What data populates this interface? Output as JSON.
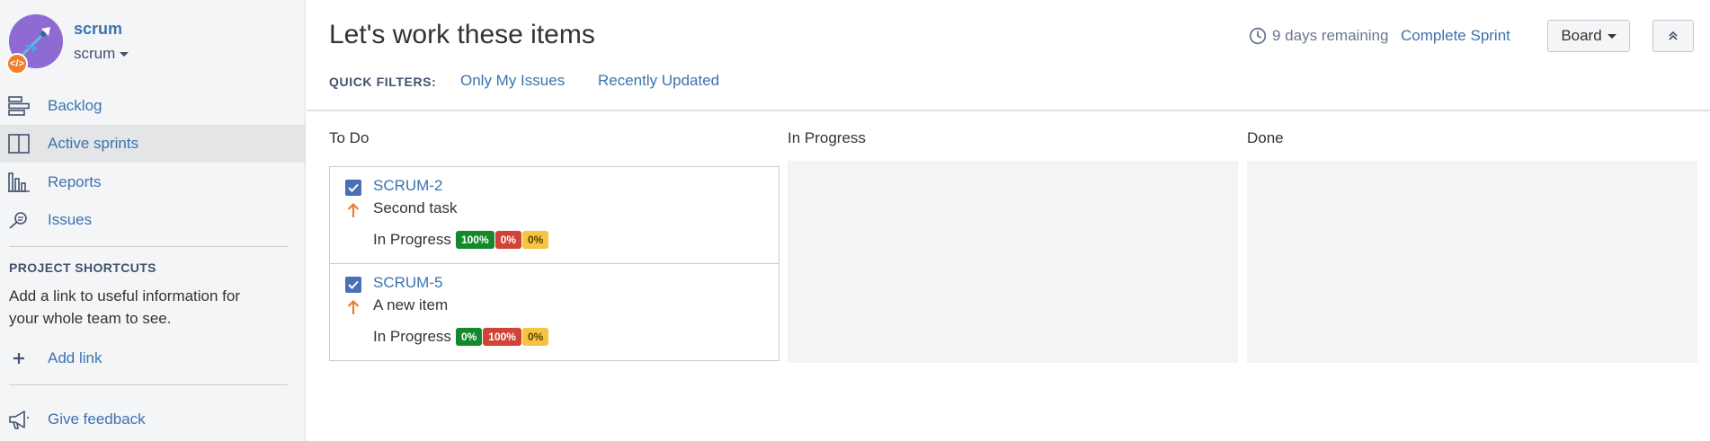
{
  "sidebar": {
    "project_name": "scrum",
    "project_type": "scrum",
    "nav": [
      {
        "label": "Backlog",
        "icon": "backlog-icon"
      },
      {
        "label": "Active sprints",
        "icon": "active-sprints-icon"
      },
      {
        "label": "Reports",
        "icon": "reports-icon"
      },
      {
        "label": "Issues",
        "icon": "issues-icon"
      }
    ],
    "shortcuts_title": "PROJECT SHORTCUTS",
    "shortcuts_text": "Add a link to useful information for your whole team to see.",
    "add_link_label": "Add link",
    "feedback_label": "Give feedback"
  },
  "header": {
    "title": "Let's work these items",
    "quick_filters_label": "QUICK FILTERS:",
    "quick_filters": [
      "Only My Issues",
      "Recently Updated"
    ],
    "days_remaining": "9 days remaining",
    "complete_sprint": "Complete Sprint",
    "board_button": "Board"
  },
  "columns": [
    "To Do",
    "In Progress",
    "Done"
  ],
  "cards": [
    {
      "key": "SCRUM-2",
      "summary": "Second task",
      "status": "In Progress",
      "pills": [
        {
          "label": "100%",
          "color": "#14892c"
        },
        {
          "label": "0%",
          "color": "#d04437"
        },
        {
          "label": "0%",
          "color": "#f6c342"
        }
      ]
    },
    {
      "key": "SCRUM-5",
      "summary": "A new item",
      "status": "In Progress",
      "pills": [
        {
          "label": "0%",
          "color": "#14892c"
        },
        {
          "label": "100%",
          "color": "#d04437"
        },
        {
          "label": "0%",
          "color": "#f6c342"
        }
      ]
    }
  ],
  "colors": {
    "link": "#3b73af",
    "sidebar_bg": "#f4f5f7",
    "priority_arrow": "#e97f33"
  }
}
